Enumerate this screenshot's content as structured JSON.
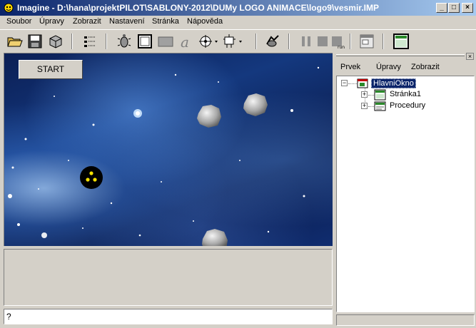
{
  "window": {
    "title": "Imagine - D:\\hana\\projektPILOT\\SABLONY-2012\\DUMy LOGO ANIMACE\\logo9\\vesmir.IMP",
    "min_glyph": "_",
    "max_glyph": "□",
    "close_glyph": "×"
  },
  "menu": [
    "Soubor",
    "Úpravy",
    "Zobrazit",
    "Nastavení",
    "Stránka",
    "Nápověda"
  ],
  "toolbar_icons": [
    "open-folder-icon",
    "save-icon",
    "package-icon",
    "grid-icon",
    "turtle-icon",
    "window-icon",
    "rectangle-icon",
    "text-a-icon",
    "clip-icon",
    "robot-icon",
    "turtle-run-icon",
    "pause-icon",
    "stop-icon",
    "run-icon",
    "page-icon",
    "page-active-icon"
  ],
  "page": {
    "start_button": "START"
  },
  "command_line": {
    "prompt": "?"
  },
  "right_pane": {
    "close_glyph": "×",
    "menu": [
      "Prvek",
      "Úpravy",
      "Zobrazit"
    ],
    "tree": {
      "root_label": "HlavniOkno",
      "children": [
        "Stránka1",
        "Procedury"
      ],
      "expander": "+",
      "root_expander": "−"
    }
  },
  "colors": {
    "titlebar_start": "#0a246a",
    "titlebar_end": "#a6caf0",
    "selection": "#0a246a",
    "space": "#14387e",
    "ship_eyes": "#f5e000"
  }
}
